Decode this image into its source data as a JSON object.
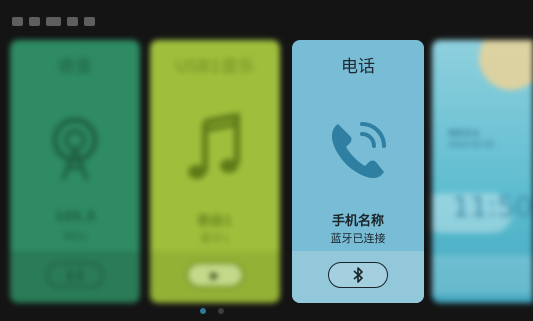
{
  "status_icons": [
    "signal-icon",
    "signal-icon",
    "wifi-icon",
    "battery-icon",
    "volume-icon"
  ],
  "cards": {
    "radio": {
      "title": "收音",
      "freq": "105.5",
      "unit": "MHz",
      "button": "pause"
    },
    "usb": {
      "title": "USB1音乐",
      "song": "歌曲1",
      "artist": "歌手1",
      "button": "play"
    },
    "phone": {
      "title": "电话",
      "device_name": "手机名称",
      "status": "蓝牙已连接",
      "button": "bluetooth"
    },
    "weather": {
      "line1": "晴转多云",
      "line2": "2020-02-02",
      "time": "11:50"
    }
  },
  "pager": {
    "count": 2,
    "active": 0
  },
  "colors": {
    "radio": "#2e8b63",
    "usb": "#9fbf3c",
    "phone": "#79bcd6",
    "weather": "#5cbccf"
  }
}
